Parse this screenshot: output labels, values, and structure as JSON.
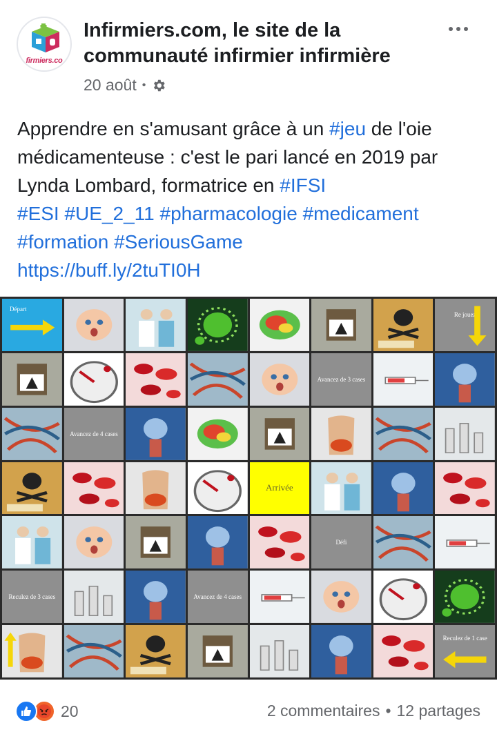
{
  "post": {
    "page_name": "Infirmiers.com, le site de la communauté infirmier infirmière",
    "avatar_text": "firmiers.co",
    "date": "20 août",
    "privacy_icon": "gear-icon",
    "more_icon": "more-dots-icon",
    "text_before_1": "Apprendre en s'amusant grâce à un ",
    "tag_jeu": "#jeu",
    "text_before_2": " de l'oie médicamenteuse : c'est le pari lancé en 2019 par Lynda Lombard, formatrice en ",
    "tag_ifsi": "#IFSI",
    "tag_esi": "#ESI",
    "tag_ue": "#UE_2_11",
    "tag_pharmaco": "#pharmacologie",
    "tag_medicament": "#medicament",
    "tag_formation": "#formation",
    "tag_serious": "#SeriousGame",
    "link": "https://buff.ly/2tuTI0H"
  },
  "board": {
    "labels": {
      "depart": "Départ",
      "rejouez": "Re jouez",
      "avancez3": "Avancez de 3 cases",
      "avancez4a": "Avancez de 4 cases",
      "arrivee": "Arrivée",
      "defi": "Défi",
      "reculez3": "Reculez de 3 cases",
      "avancez4b": "Avancez de 4 cases",
      "reculez1": "Reculez de 1 case"
    },
    "colors": {
      "depart": "#29a9e1",
      "arrivee": "#ffff00",
      "arrow": "#f5d60a"
    }
  },
  "footer": {
    "reaction_count": "20",
    "comments": "2 commentaires",
    "separator": "•",
    "shares": "12 partages",
    "colors": {
      "like": "#1877f2",
      "angry": "#f0642a"
    }
  }
}
